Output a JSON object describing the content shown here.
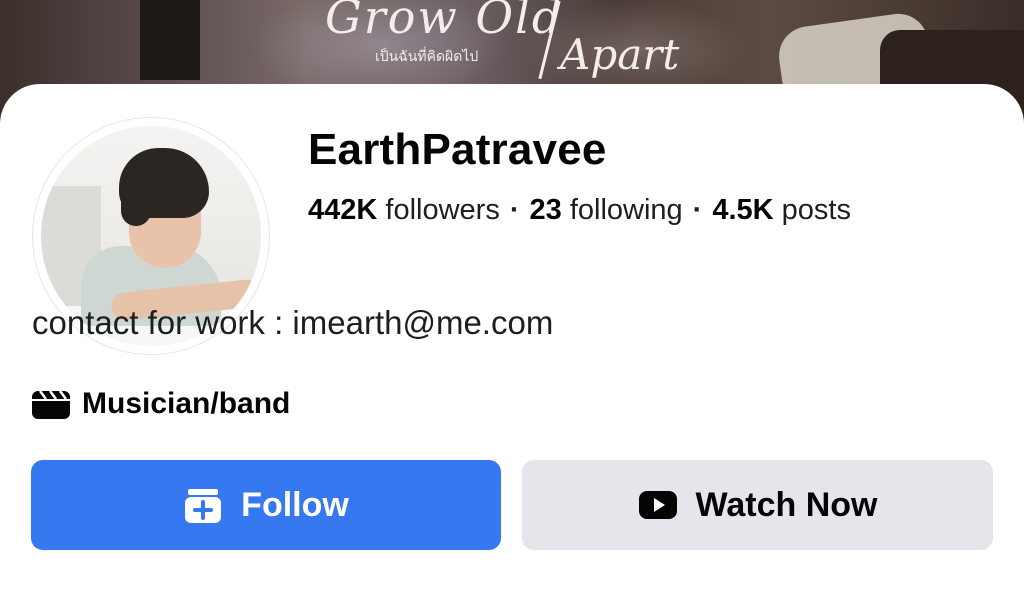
{
  "cover": {
    "title_line1": "Grow Old",
    "title_thai": "เป็นฉันที่คิดผิดไป",
    "title_line2": "Apart"
  },
  "profile": {
    "name": "EarthPatravee",
    "followers_count": "442K",
    "followers_label": "followers",
    "following_count": "23",
    "following_label": "following",
    "posts_count": "4.5K",
    "posts_label": "posts",
    "separator": "·",
    "bio": "contact for work : imearth@me.com",
    "category": "Musician/band",
    "category_icon": "clapperboard-icon"
  },
  "actions": {
    "follow_label": "Follow",
    "follow_icon": "follow-box-icon",
    "watch_label": "Watch Now",
    "watch_icon": "play-icon"
  },
  "colors": {
    "primary": "#3578f0",
    "secondary_button": "#e4e6eb",
    "text": "#050505"
  }
}
